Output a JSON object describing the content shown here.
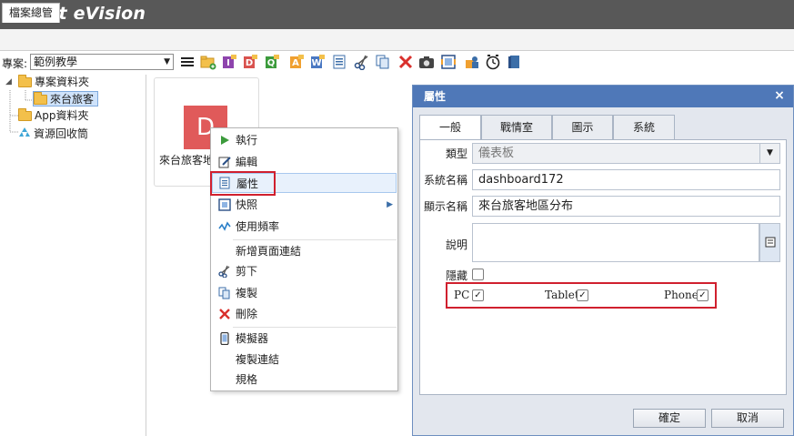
{
  "app": {
    "title": "Smart eVision"
  },
  "tabs": [
    {
      "label": "檔案總管"
    }
  ],
  "toolbar": {
    "project_label": "專案:",
    "project_value": "範例教學",
    "icons": [
      "menu-icon",
      "new-folder-icon",
      "new-i-report-icon",
      "new-d-dashboard-icon",
      "new-q-query-icon",
      "new-a-analysis-icon",
      "new-w-word-icon",
      "properties-icon",
      "cut-icon",
      "copy-icon",
      "delete-icon",
      "snapshot-icon",
      "gallery-icon",
      "permissions-icon",
      "schedule-icon",
      "book-icon"
    ]
  },
  "tree": {
    "items": [
      {
        "label": "專案資料夾",
        "icon": "folder-icon"
      },
      {
        "label": "來台旅客",
        "icon": "folder-icon"
      },
      {
        "label": "App資料夾",
        "icon": "folder-icon"
      },
      {
        "label": "資源回收筒",
        "icon": "recycle-bin-icon"
      }
    ]
  },
  "item": {
    "letter": "D",
    "label": "來台旅客地"
  },
  "context_menu": {
    "items": [
      {
        "label": "執行",
        "icon": "play-icon"
      },
      {
        "label": "編輯",
        "icon": "edit-icon"
      },
      {
        "label": "屬性",
        "icon": "properties-icon"
      },
      {
        "label": "快照",
        "icon": "snapshot-icon",
        "submenu": true
      },
      {
        "label": "使用頻率",
        "icon": "usage-chart-icon"
      },
      {
        "label": "新增頁面連結",
        "icon": ""
      },
      {
        "label": "剪下",
        "icon": "cut-icon"
      },
      {
        "label": "複製",
        "icon": "copy-icon"
      },
      {
        "label": "刪除",
        "icon": "delete-icon"
      },
      {
        "label": "模擬器",
        "icon": "phone-icon"
      },
      {
        "label": "複製連結",
        "icon": ""
      },
      {
        "label": "規格",
        "icon": ""
      }
    ]
  },
  "dialog": {
    "title": "屬性",
    "close": "×",
    "tabs": [
      "一般",
      "戰情室",
      "圖示",
      "系統"
    ],
    "fields": {
      "type_label": "類型",
      "type_value": "儀表板",
      "sysname_label": "系統名稱",
      "sysname_value": "dashboard172",
      "dispname_label": "顯示名稱",
      "dispname_value": "來台旅客地區分布",
      "desc_label": "說明",
      "desc_value": "",
      "hidden_label": "隱藏"
    },
    "devices": [
      {
        "label": "PC",
        "checked": true
      },
      {
        "label": "Tablet",
        "checked": true
      },
      {
        "label": "Phone",
        "checked": true
      }
    ],
    "ok": "確定",
    "cancel": "取消"
  },
  "colors": {
    "titlebar": "#585858",
    "dialog_header": "#4f78b8",
    "highlight": "#d0202e",
    "item_tile": "#e05a5a"
  }
}
